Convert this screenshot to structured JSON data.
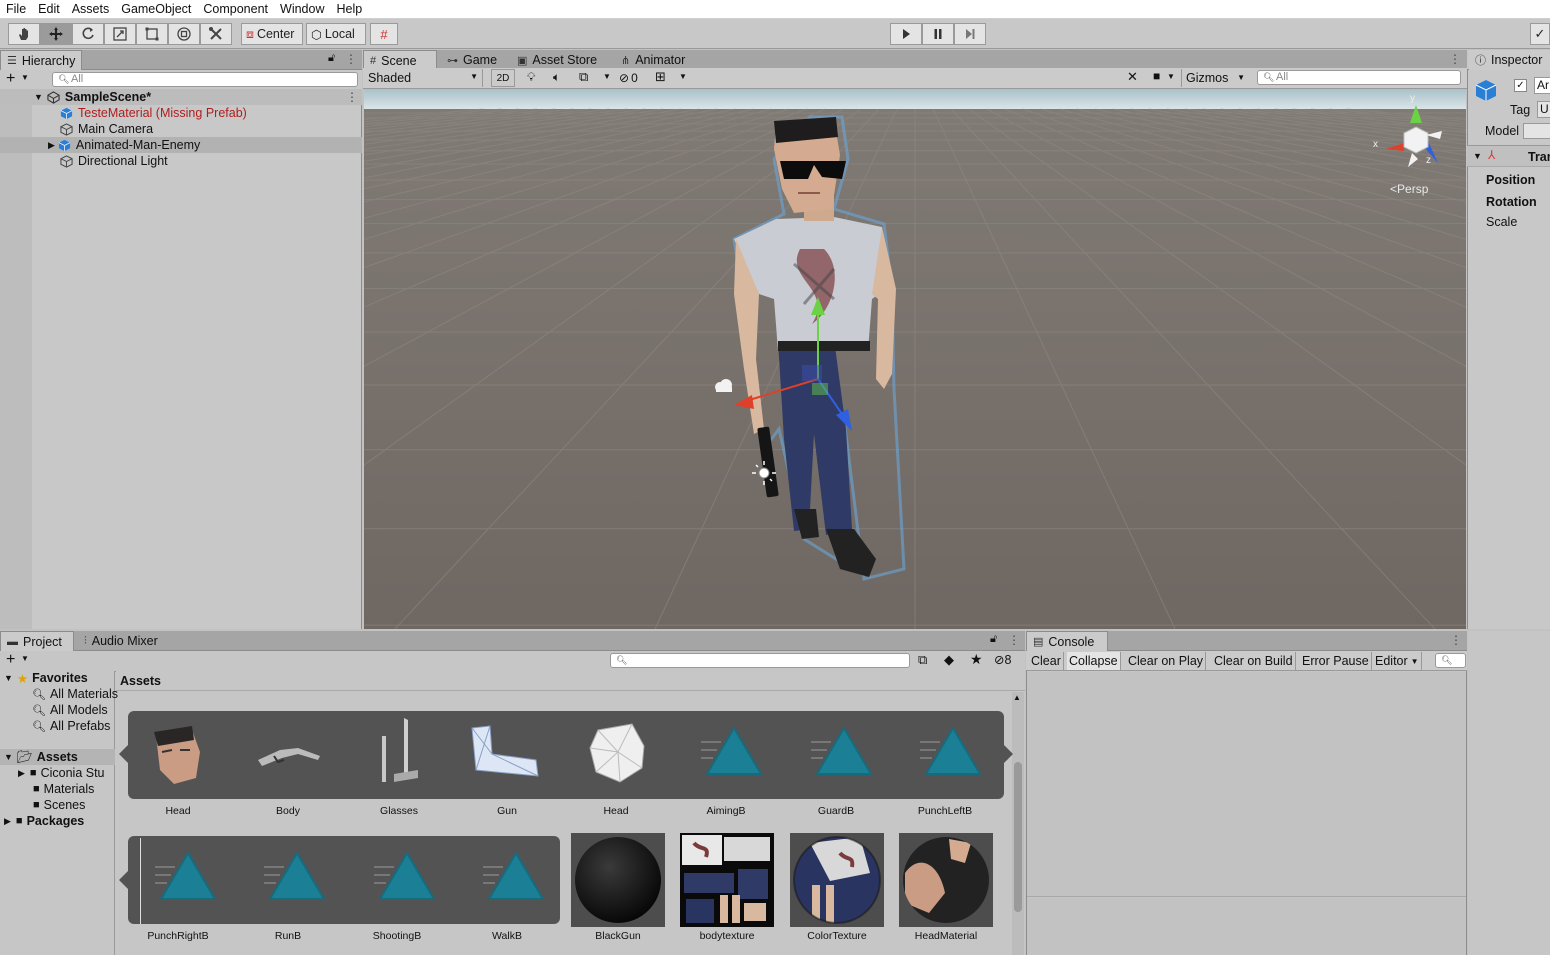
{
  "menu": [
    "File",
    "Edit",
    "Assets",
    "GameObject",
    "Component",
    "Window",
    "Help"
  ],
  "toolbar": {
    "pivot": "Center",
    "space": "Local"
  },
  "hierarchy": {
    "tab": "Hierarchy",
    "search_placeholder": "All",
    "scene_name": "SampleScene*",
    "items": [
      {
        "label": "TesteMaterial (Missing Prefab)",
        "missing": true
      },
      {
        "label": "Main Camera"
      },
      {
        "label": "Animated-Man-Enemy"
      },
      {
        "label": "Directional Light"
      }
    ]
  },
  "scene_tabs": [
    "Scene",
    "Game",
    "Asset Store",
    "Animator"
  ],
  "scene_toolbar": {
    "shading": "Shaded",
    "mode_2d": "2D",
    "hidden_count": "0",
    "gizmos": "Gizmos",
    "search_placeholder": "All"
  },
  "gizmo": {
    "x": "x",
    "y": "y",
    "z": "z",
    "persp": "Persp"
  },
  "inspector": {
    "tab": "Inspector",
    "name_partial": "Ar",
    "tag_label": "Tag",
    "tag_value": "U",
    "model_label": "Model",
    "component": "Trar",
    "fields": [
      "Position",
      "Rotation",
      "Scale"
    ]
  },
  "project": {
    "tabs": [
      "Project",
      "Audio Mixer"
    ],
    "hidden_count": "8",
    "favorites_label": "Favorites",
    "favorites": [
      "All Materials",
      "All Models",
      "All Prefabs"
    ],
    "assets_label": "Assets",
    "asset_folders": [
      "Ciconia Stu",
      "Materials",
      "Scenes"
    ],
    "packages_label": "Packages",
    "breadcrumb": "Assets",
    "row1": [
      "Head",
      "Body",
      "Glasses",
      "Gun",
      "Head",
      "AimingB",
      "GuardB",
      "PunchLeftB"
    ],
    "row2_anims": [
      "PunchRightB",
      "RunB",
      "ShootingB",
      "WalkB"
    ],
    "row2_items": [
      "BlackGun",
      "bodytexture",
      "ColorTexture",
      "HeadMaterial"
    ]
  },
  "console": {
    "tab": "Console",
    "buttons": [
      "Clear",
      "Collapse",
      "Clear on Play",
      "Clear on Build",
      "Error Pause",
      "Editor"
    ]
  },
  "colors": {
    "anim_teal": "#1b7f95",
    "missing_red": "#b01e1e",
    "cube_blue": "#2a7fd4"
  }
}
